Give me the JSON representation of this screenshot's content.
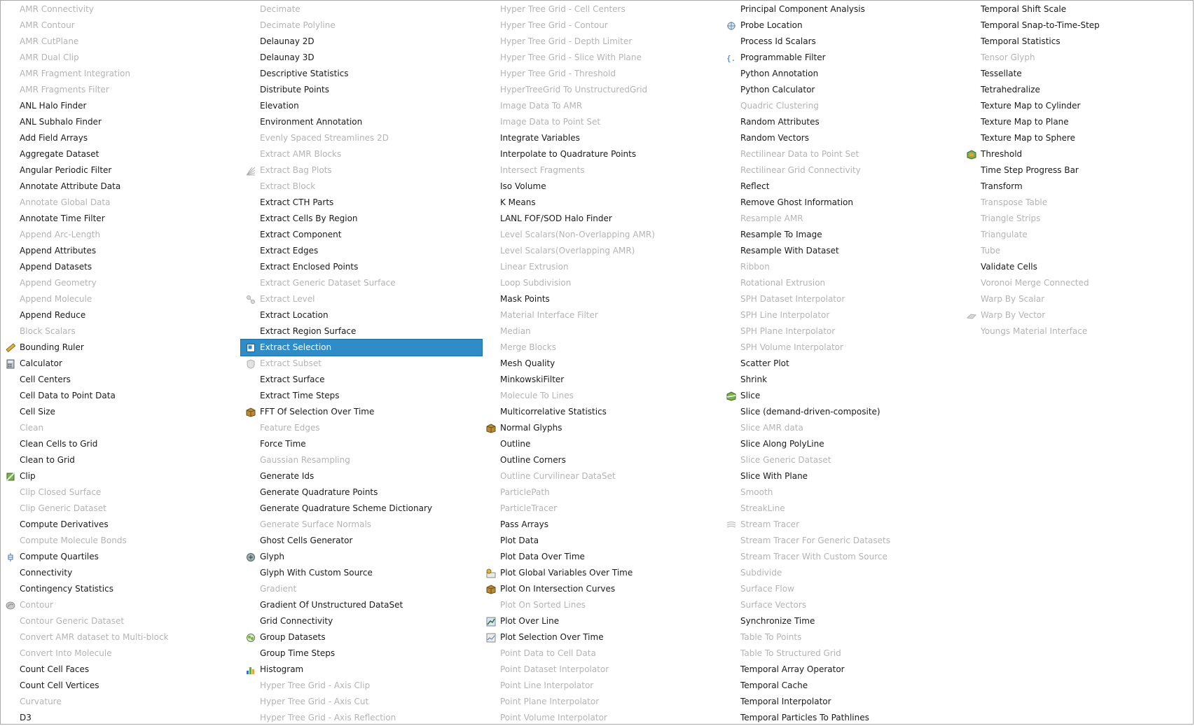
{
  "columns": [
    [
      {
        "label": "AMR Connectivity",
        "enabled": false
      },
      {
        "label": "AMR Contour",
        "enabled": false
      },
      {
        "label": "AMR CutPlane",
        "enabled": false
      },
      {
        "label": "AMR Dual Clip",
        "enabled": false
      },
      {
        "label": "AMR Fragment Integration",
        "enabled": false
      },
      {
        "label": "AMR Fragments Filter",
        "enabled": false
      },
      {
        "label": "ANL Halo Finder",
        "enabled": true
      },
      {
        "label": "ANL Subhalo Finder",
        "enabled": true
      },
      {
        "label": "Add Field Arrays",
        "enabled": true
      },
      {
        "label": "Aggregate Dataset",
        "enabled": true
      },
      {
        "label": "Angular Periodic Filter",
        "enabled": true
      },
      {
        "label": "Annotate Attribute Data",
        "enabled": true
      },
      {
        "label": "Annotate Global Data",
        "enabled": false
      },
      {
        "label": "Annotate Time Filter",
        "enabled": true
      },
      {
        "label": "Append Arc-Length",
        "enabled": false
      },
      {
        "label": "Append Attributes",
        "enabled": true
      },
      {
        "label": "Append Datasets",
        "enabled": true
      },
      {
        "label": "Append Geometry",
        "enabled": false
      },
      {
        "label": "Append Molecule",
        "enabled": false
      },
      {
        "label": "Append Reduce",
        "enabled": true
      },
      {
        "label": "Block Scalars",
        "enabled": false
      },
      {
        "label": "Bounding Ruler",
        "enabled": true,
        "icon": "ruler-icon"
      },
      {
        "label": "Calculator",
        "enabled": true,
        "icon": "calculator-icon"
      },
      {
        "label": "Cell Centers",
        "enabled": true
      },
      {
        "label": "Cell Data to Point Data",
        "enabled": true
      },
      {
        "label": "Cell Size",
        "enabled": true
      },
      {
        "label": "Clean",
        "enabled": false
      },
      {
        "label": "Clean Cells to Grid",
        "enabled": true
      },
      {
        "label": "Clean to Grid",
        "enabled": true
      },
      {
        "label": "Clip",
        "enabled": true,
        "icon": "clip-icon"
      },
      {
        "label": "Clip Closed Surface",
        "enabled": false
      },
      {
        "label": "Clip Generic Dataset",
        "enabled": false
      },
      {
        "label": "Compute Derivatives",
        "enabled": true
      },
      {
        "label": "Compute Molecule Bonds",
        "enabled": false
      },
      {
        "label": "Compute Quartiles",
        "enabled": true,
        "icon": "boxplot-icon"
      },
      {
        "label": "Connectivity",
        "enabled": true
      },
      {
        "label": "Contingency Statistics",
        "enabled": true
      },
      {
        "label": "Contour",
        "enabled": false,
        "icon": "contour-icon"
      },
      {
        "label": "Contour Generic Dataset",
        "enabled": false
      },
      {
        "label": "Convert AMR dataset to Multi-block",
        "enabled": false
      },
      {
        "label": "Convert Into Molecule",
        "enabled": false
      },
      {
        "label": "Count Cell Faces",
        "enabled": true
      },
      {
        "label": "Count Cell Vertices",
        "enabled": true
      },
      {
        "label": "Curvature",
        "enabled": false
      },
      {
        "label": "D3",
        "enabled": true
      }
    ],
    [
      {
        "label": "Decimate",
        "enabled": false
      },
      {
        "label": "Decimate Polyline",
        "enabled": false
      },
      {
        "label": "Delaunay 2D",
        "enabled": true
      },
      {
        "label": "Delaunay 3D",
        "enabled": true
      },
      {
        "label": "Descriptive Statistics",
        "enabled": true
      },
      {
        "label": "Distribute Points",
        "enabled": true
      },
      {
        "label": "Elevation",
        "enabled": true
      },
      {
        "label": "Environment Annotation",
        "enabled": true
      },
      {
        "label": "Evenly Spaced Streamlines 2D",
        "enabled": false
      },
      {
        "label": "Extract AMR Blocks",
        "enabled": false
      },
      {
        "label": "Extract Bag Plots",
        "enabled": false,
        "icon": "bag-plot-icon"
      },
      {
        "label": "Extract Block",
        "enabled": false
      },
      {
        "label": "Extract CTH Parts",
        "enabled": true
      },
      {
        "label": "Extract Cells By Region",
        "enabled": true
      },
      {
        "label": "Extract Component",
        "enabled": true
      },
      {
        "label": "Extract Edges",
        "enabled": true
      },
      {
        "label": "Extract Enclosed Points",
        "enabled": true
      },
      {
        "label": "Extract Generic Dataset Surface",
        "enabled": false
      },
      {
        "label": "Extract Level",
        "enabled": false,
        "icon": "extract-level-icon"
      },
      {
        "label": "Extract Location",
        "enabled": true
      },
      {
        "label": "Extract Region Surface",
        "enabled": true
      },
      {
        "label": "Extract Selection",
        "enabled": true,
        "selected": true,
        "icon": "extract-selection-icon"
      },
      {
        "label": "Extract Subset",
        "enabled": false,
        "icon": "extract-subset-icon"
      },
      {
        "label": "Extract Surface",
        "enabled": true
      },
      {
        "label": "Extract Time Steps",
        "enabled": true
      },
      {
        "label": "FFT Of Selection Over Time",
        "enabled": true,
        "icon": "cube-icon"
      },
      {
        "label": "Feature Edges",
        "enabled": false
      },
      {
        "label": "Force Time",
        "enabled": true
      },
      {
        "label": "Gaussian Resampling",
        "enabled": false
      },
      {
        "label": "Generate Ids",
        "enabled": true
      },
      {
        "label": "Generate Quadrature Points",
        "enabled": true
      },
      {
        "label": "Generate Quadrature Scheme Dictionary",
        "enabled": true
      },
      {
        "label": "Generate Surface Normals",
        "enabled": false
      },
      {
        "label": "Ghost Cells Generator",
        "enabled": true
      },
      {
        "label": "Glyph",
        "enabled": true,
        "icon": "glyph-icon"
      },
      {
        "label": "Glyph With Custom Source",
        "enabled": true
      },
      {
        "label": "Gradient",
        "enabled": false
      },
      {
        "label": "Gradient Of Unstructured DataSet",
        "enabled": true
      },
      {
        "label": "Grid Connectivity",
        "enabled": true
      },
      {
        "label": "Group Datasets",
        "enabled": true,
        "icon": "group-icon"
      },
      {
        "label": "Group Time Steps",
        "enabled": true
      },
      {
        "label": "Histogram",
        "enabled": true,
        "icon": "histogram-icon"
      },
      {
        "label": "Hyper Tree Grid - Axis Clip",
        "enabled": false
      },
      {
        "label": "Hyper Tree Grid - Axis Cut",
        "enabled": false
      },
      {
        "label": "Hyper Tree Grid - Axis Reflection",
        "enabled": false
      }
    ],
    [
      {
        "label": "Hyper Tree Grid - Cell Centers",
        "enabled": false
      },
      {
        "label": "Hyper Tree Grid - Contour",
        "enabled": false
      },
      {
        "label": "Hyper Tree Grid - Depth Limiter",
        "enabled": false
      },
      {
        "label": "Hyper Tree Grid - Slice With Plane",
        "enabled": false
      },
      {
        "label": "Hyper Tree Grid - Threshold",
        "enabled": false
      },
      {
        "label": "HyperTreeGrid To UnstructuredGrid",
        "enabled": false
      },
      {
        "label": "Image Data To AMR",
        "enabled": false
      },
      {
        "label": "Image Data to Point Set",
        "enabled": false
      },
      {
        "label": "Integrate Variables",
        "enabled": true
      },
      {
        "label": "Interpolate to Quadrature Points",
        "enabled": true
      },
      {
        "label": "Intersect Fragments",
        "enabled": false
      },
      {
        "label": "Iso Volume",
        "enabled": true
      },
      {
        "label": "K Means",
        "enabled": true
      },
      {
        "label": "LANL FOF/SOD Halo Finder",
        "enabled": true
      },
      {
        "label": "Level Scalars(Non-Overlapping AMR)",
        "enabled": false
      },
      {
        "label": "Level Scalars(Overlapping AMR)",
        "enabled": false
      },
      {
        "label": "Linear Extrusion",
        "enabled": false
      },
      {
        "label": "Loop Subdivision",
        "enabled": false
      },
      {
        "label": "Mask Points",
        "enabled": true
      },
      {
        "label": "Material Interface Filter",
        "enabled": false
      },
      {
        "label": "Median",
        "enabled": false
      },
      {
        "label": "Merge Blocks",
        "enabled": false
      },
      {
        "label": "Mesh Quality",
        "enabled": true
      },
      {
        "label": "MinkowskiFilter",
        "enabled": true
      },
      {
        "label": "Molecule To Lines",
        "enabled": false
      },
      {
        "label": "Multicorrelative Statistics",
        "enabled": true
      },
      {
        "label": "Normal Glyphs",
        "enabled": true,
        "icon": "cube-icon"
      },
      {
        "label": "Outline",
        "enabled": true
      },
      {
        "label": "Outline Corners",
        "enabled": true
      },
      {
        "label": "Outline Curvilinear DataSet",
        "enabled": false
      },
      {
        "label": "ParticlePath",
        "enabled": false
      },
      {
        "label": "ParticleTracer",
        "enabled": false
      },
      {
        "label": "Pass Arrays",
        "enabled": true
      },
      {
        "label": "Plot Data",
        "enabled": true
      },
      {
        "label": "Plot Data Over Time",
        "enabled": true
      },
      {
        "label": "Plot Global Variables Over Time",
        "enabled": true,
        "icon": "plot-global-icon"
      },
      {
        "label": "Plot On Intersection Curves",
        "enabled": true,
        "icon": "cube-icon"
      },
      {
        "label": "Plot On Sorted Lines",
        "enabled": false
      },
      {
        "label": "Plot Over Line",
        "enabled": true,
        "icon": "plot-line-icon"
      },
      {
        "label": "Plot Selection Over Time",
        "enabled": true,
        "icon": "plot-selection-icon"
      },
      {
        "label": "Point Data to Cell Data",
        "enabled": false
      },
      {
        "label": "Point Dataset Interpolator",
        "enabled": false
      },
      {
        "label": "Point Line Interpolator",
        "enabled": false
      },
      {
        "label": "Point Plane Interpolator",
        "enabled": false
      },
      {
        "label": "Point Volume Interpolator",
        "enabled": false
      }
    ],
    [
      {
        "label": "Principal Component Analysis",
        "enabled": true
      },
      {
        "label": "Probe Location",
        "enabled": true,
        "icon": "probe-icon"
      },
      {
        "label": "Process Id Scalars",
        "enabled": true
      },
      {
        "label": "Programmable Filter",
        "enabled": true,
        "icon": "braces-icon"
      },
      {
        "label": "Python Annotation",
        "enabled": true
      },
      {
        "label": "Python Calculator",
        "enabled": true
      },
      {
        "label": "Quadric Clustering",
        "enabled": false
      },
      {
        "label": "Random Attributes",
        "enabled": true
      },
      {
        "label": "Random Vectors",
        "enabled": true
      },
      {
        "label": "Rectilinear Data to Point Set",
        "enabled": false
      },
      {
        "label": "Rectilinear Grid Connectivity",
        "enabled": false
      },
      {
        "label": "Reflect",
        "enabled": true
      },
      {
        "label": "Remove Ghost Information",
        "enabled": true
      },
      {
        "label": "Resample AMR",
        "enabled": false
      },
      {
        "label": "Resample To Image",
        "enabled": true
      },
      {
        "label": "Resample With Dataset",
        "enabled": true
      },
      {
        "label": "Ribbon",
        "enabled": false
      },
      {
        "label": "Rotational Extrusion",
        "enabled": false
      },
      {
        "label": "SPH Dataset Interpolator",
        "enabled": false
      },
      {
        "label": "SPH Line Interpolator",
        "enabled": false
      },
      {
        "label": "SPH Plane Interpolator",
        "enabled": false
      },
      {
        "label": "SPH Volume Interpolator",
        "enabled": false
      },
      {
        "label": "Scatter Plot",
        "enabled": true
      },
      {
        "label": "Shrink",
        "enabled": true
      },
      {
        "label": "Slice",
        "enabled": true,
        "icon": "slice-icon"
      },
      {
        "label": "Slice (demand-driven-composite)",
        "enabled": true
      },
      {
        "label": "Slice AMR data",
        "enabled": false
      },
      {
        "label": "Slice Along PolyLine",
        "enabled": true
      },
      {
        "label": "Slice Generic Dataset",
        "enabled": false
      },
      {
        "label": "Slice With Plane",
        "enabled": true
      },
      {
        "label": "Smooth",
        "enabled": false
      },
      {
        "label": "StreakLine",
        "enabled": false
      },
      {
        "label": "Stream Tracer",
        "enabled": false,
        "icon": "stream-icon"
      },
      {
        "label": "Stream Tracer For Generic Datasets",
        "enabled": false
      },
      {
        "label": "Stream Tracer With Custom Source",
        "enabled": false
      },
      {
        "label": "Subdivide",
        "enabled": false
      },
      {
        "label": "Surface Flow",
        "enabled": false
      },
      {
        "label": "Surface Vectors",
        "enabled": false
      },
      {
        "label": "Synchronize Time",
        "enabled": true
      },
      {
        "label": "Table To Points",
        "enabled": false
      },
      {
        "label": "Table To Structured Grid",
        "enabled": false
      },
      {
        "label": "Temporal Array Operator",
        "enabled": true
      },
      {
        "label": "Temporal Cache",
        "enabled": true
      },
      {
        "label": "Temporal Interpolator",
        "enabled": true
      },
      {
        "label": "Temporal Particles To Pathlines",
        "enabled": true
      }
    ],
    [
      {
        "label": "Temporal Shift Scale",
        "enabled": true
      },
      {
        "label": "Temporal Snap-to-Time-Step",
        "enabled": true
      },
      {
        "label": "Temporal Statistics",
        "enabled": true
      },
      {
        "label": "Tensor Glyph",
        "enabled": false
      },
      {
        "label": "Tessellate",
        "enabled": true
      },
      {
        "label": "Tetrahedralize",
        "enabled": true
      },
      {
        "label": "Texture Map to Cylinder",
        "enabled": true
      },
      {
        "label": "Texture Map to Plane",
        "enabled": true
      },
      {
        "label": "Texture Map to Sphere",
        "enabled": true
      },
      {
        "label": "Threshold",
        "enabled": true,
        "icon": "threshold-icon"
      },
      {
        "label": "Time Step Progress Bar",
        "enabled": true
      },
      {
        "label": "Transform",
        "enabled": true
      },
      {
        "label": "Transpose Table",
        "enabled": false
      },
      {
        "label": "Triangle Strips",
        "enabled": false
      },
      {
        "label": "Triangulate",
        "enabled": false
      },
      {
        "label": "Tube",
        "enabled": false
      },
      {
        "label": "Validate Cells",
        "enabled": true
      },
      {
        "label": "Voronoi Merge Connected",
        "enabled": false
      },
      {
        "label": "Warp By Scalar",
        "enabled": false
      },
      {
        "label": "Warp By Vector",
        "enabled": false,
        "icon": "warp-vector-icon"
      },
      {
        "label": "Youngs Material Interface",
        "enabled": false
      }
    ]
  ],
  "colors": {
    "selection_bg": "#308cc6",
    "enabled_text": "#1a1a1a",
    "disabled_text": "#b4b4b4"
  }
}
